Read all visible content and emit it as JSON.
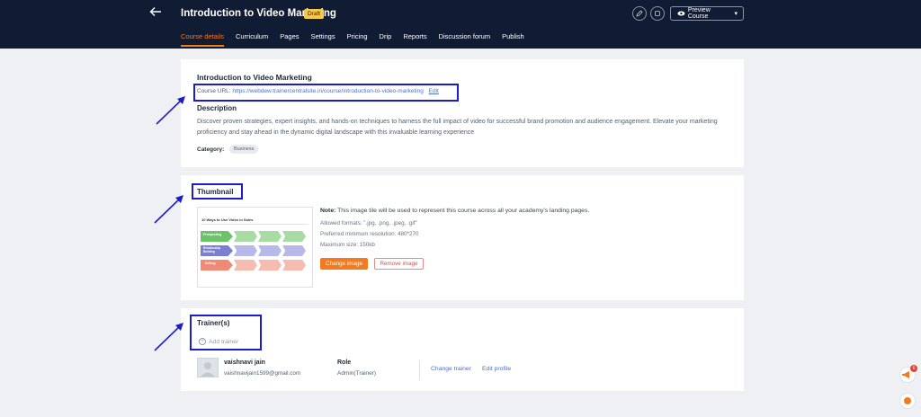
{
  "header": {
    "back_icon": "arrow-left-icon",
    "title": "Introduction to Video Marketing",
    "badge": "Draft",
    "preview_label": "Preview Course",
    "tabs": [
      {
        "label": "Course details",
        "active": true
      },
      {
        "label": "Curriculum"
      },
      {
        "label": "Pages"
      },
      {
        "label": "Settings"
      },
      {
        "label": "Pricing"
      },
      {
        "label": "Drip"
      },
      {
        "label": "Reports"
      },
      {
        "label": "Discussion forum"
      },
      {
        "label": "Publish"
      }
    ]
  },
  "details": {
    "title": "Introduction to Video Marketing",
    "url_label": "Course URL:",
    "url": "https://webdew.trainercentralsite.in/course/introduction-to-video-marketing",
    "edit_label": "Edit",
    "description_heading": "Description",
    "description": "Discover proven strategies, expert insights, and hands-on techniques to harness the full impact of video for successful brand promotion and audience engagement. Elevate your marketing proficiency and stay ahead in the dynamic digital landscape with this invaluable learning experience",
    "category_label": "Category:",
    "category": "Business"
  },
  "thumbnail": {
    "heading": "Thumbnail",
    "image_title": "10 Ways to Use Video in Sales",
    "row_labels": [
      "Prospecting",
      "Relationship Building",
      "Selling"
    ],
    "note_label": "Note:",
    "note": "This image tile will be used to represent this course across all your academy's landing pages.",
    "formats": "Allowed formats: \".jpg, .png, .jpeg, .gif\"",
    "resolution": "Preferred minimum resolution: 480*270",
    "max_size": "Maximum size: 150kb",
    "change_label": "Change image",
    "remove_label": "Remove image"
  },
  "trainers": {
    "heading": "Trainer(s)",
    "add_label": "Add trainer",
    "name": "vaishnavi jain",
    "email": "vaishnavijain1599@gmail.com",
    "role_label": "Role",
    "role": "Admin(Trainer)",
    "change_label": "Change trainer",
    "edit_profile_label": "Edit profile"
  },
  "widgets": {
    "badge_count": "6"
  },
  "colors": {
    "accent": "#f47a20",
    "header_bg": "#0f1c33",
    "highlight": "#1c1ccf",
    "link": "#4d6fd1"
  }
}
